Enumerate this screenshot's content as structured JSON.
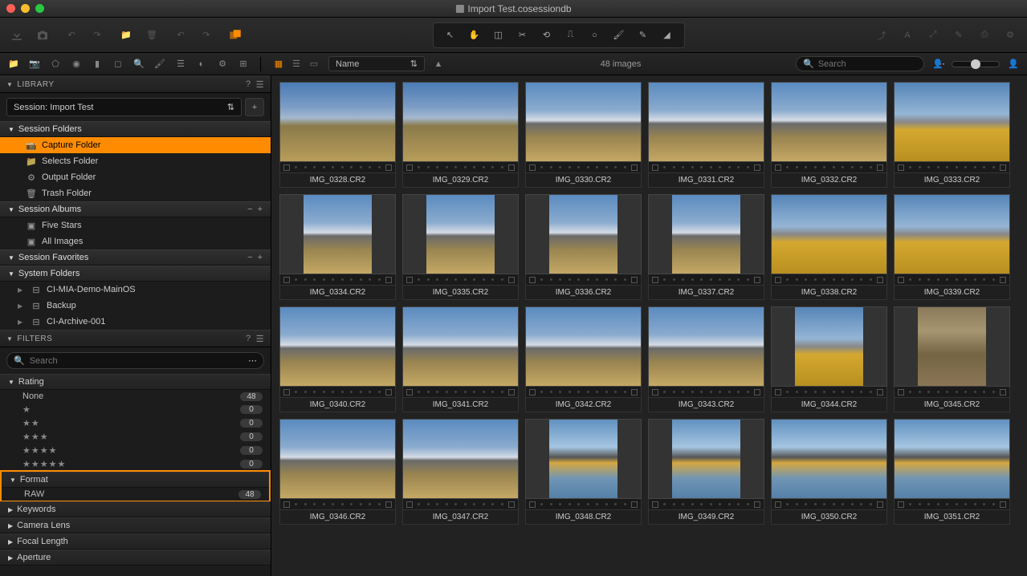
{
  "window": {
    "title": "Import Test.cosessiondb"
  },
  "tooltabs": {
    "sort_label": "Name",
    "count_label": "48 images",
    "search_placeholder": "Search"
  },
  "library": {
    "header": "LIBRARY",
    "session": "Session: Import Test",
    "session_folders_hdr": "Session Folders",
    "session_folders": [
      {
        "label": "Capture Folder",
        "selected": true,
        "icon": "camera"
      },
      {
        "label": "Selects Folder",
        "selected": false,
        "icon": "folder"
      },
      {
        "label": "Output Folder",
        "selected": false,
        "icon": "gear"
      },
      {
        "label": "Trash Folder",
        "selected": false,
        "icon": "trash"
      }
    ],
    "session_albums_hdr": "Session Albums",
    "session_albums": [
      {
        "label": "Five Stars"
      },
      {
        "label": "All Images"
      }
    ],
    "session_favorites_hdr": "Session Favorites",
    "system_folders_hdr": "System Folders",
    "system_folders": [
      {
        "label": "CI-MIA-Demo-MainOS"
      },
      {
        "label": "Backup"
      },
      {
        "label": "CI-Archive-001"
      }
    ]
  },
  "filters": {
    "header": "FILTERS",
    "search_placeholder": "Search",
    "rating_hdr": "Rating",
    "ratings": [
      {
        "label": "None",
        "count": "48",
        "stars": 0
      },
      {
        "label": "★",
        "count": "0",
        "stars": 1
      },
      {
        "label": "★★",
        "count": "0",
        "stars": 2
      },
      {
        "label": "★★★",
        "count": "0",
        "stars": 3
      },
      {
        "label": "★★★★",
        "count": "0",
        "stars": 4
      },
      {
        "label": "★★★★★",
        "count": "0",
        "stars": 5
      }
    ],
    "format_hdr": "Format",
    "formats": [
      {
        "label": "RAW",
        "count": "48"
      }
    ],
    "keywords_hdr": "Keywords",
    "camera_lens_hdr": "Camera Lens",
    "focal_length_hdr": "Focal Length",
    "aperture_hdr": "Aperture"
  },
  "images": [
    {
      "name": "IMG_0328.CR2",
      "orient": "l",
      "style": "sky-field"
    },
    {
      "name": "IMG_0329.CR2",
      "orient": "l",
      "style": "sky-field"
    },
    {
      "name": "IMG_0330.CR2",
      "orient": "l",
      "style": "sky-mtns"
    },
    {
      "name": "IMG_0331.CR2",
      "orient": "l",
      "style": "sky-mtns"
    },
    {
      "name": "IMG_0332.CR2",
      "orient": "l",
      "style": "sky-mtns"
    },
    {
      "name": "IMG_0333.CR2",
      "orient": "l",
      "style": "sky-trees"
    },
    {
      "name": "IMG_0334.CR2",
      "orient": "p",
      "style": "sky-mtns"
    },
    {
      "name": "IMG_0335.CR2",
      "orient": "p",
      "style": "sky-mtns"
    },
    {
      "name": "IMG_0336.CR2",
      "orient": "p",
      "style": "sky-mtns"
    },
    {
      "name": "IMG_0337.CR2",
      "orient": "p",
      "style": "sky-mtns"
    },
    {
      "name": "IMG_0338.CR2",
      "orient": "l",
      "style": "sky-trees"
    },
    {
      "name": "IMG_0339.CR2",
      "orient": "l",
      "style": "sky-trees"
    },
    {
      "name": "IMG_0340.CR2",
      "orient": "l",
      "style": "sky-mtns"
    },
    {
      "name": "IMG_0341.CR2",
      "orient": "l",
      "style": "sky-mtns"
    },
    {
      "name": "IMG_0342.CR2",
      "orient": "l",
      "style": "sky-mtns"
    },
    {
      "name": "IMG_0343.CR2",
      "orient": "l",
      "style": "sky-mtns"
    },
    {
      "name": "IMG_0344.CR2",
      "orient": "p",
      "style": "sky-trees"
    },
    {
      "name": "IMG_0345.CR2",
      "orient": "p",
      "style": "dry"
    },
    {
      "name": "IMG_0346.CR2",
      "orient": "l",
      "style": "sky-mtns"
    },
    {
      "name": "IMG_0347.CR2",
      "orient": "l",
      "style": "sky-mtns"
    },
    {
      "name": "IMG_0348.CR2",
      "orient": "p",
      "style": "sky-reflect"
    },
    {
      "name": "IMG_0349.CR2",
      "orient": "p",
      "style": "sky-reflect"
    },
    {
      "name": "IMG_0350.CR2",
      "orient": "l",
      "style": "sky-reflect"
    },
    {
      "name": "IMG_0351.CR2",
      "orient": "l",
      "style": "sky-reflect"
    }
  ]
}
